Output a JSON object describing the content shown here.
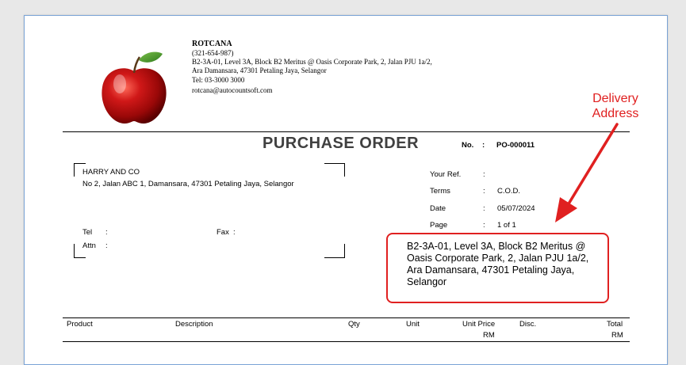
{
  "company": {
    "name": "ROTCANA",
    "phone": "(321-654-987)",
    "address_line1": "B2-3A-01, Level 3A, Block B2 Meritus @ Oasis Corporate Park, 2, Jalan PJU 1a/2,",
    "address_line2": "Ara Damansara, 47301 Petaling Jaya, Selangor",
    "tel": "Tel: 03-3000 3000",
    "email": "rotcana@autocountsoft.com",
    "logo_icon": "apple-logo"
  },
  "document": {
    "title": "PURCHASE ORDER",
    "no_label": "No.",
    "no_colon": ":",
    "no_value": "PO-000011"
  },
  "supplier": {
    "name": "HARRY AND CO",
    "address": "No 2, Jalan ABC 1, Damansara, 47301 Petaling Jaya, Selangor",
    "tel_label": "Tel",
    "fax_label": "Fax",
    "attn_label": "Attn",
    "colon": ":"
  },
  "info": [
    {
      "label": "Your Ref.",
      "colon": ":",
      "value": ""
    },
    {
      "label": "Terms",
      "colon": ":",
      "value": "C.O.D."
    },
    {
      "label": "Date",
      "colon": ":",
      "value": "05/07/2024"
    },
    {
      "label": "Page",
      "colon": ":",
      "value": "1 of 1"
    }
  ],
  "delivery": {
    "address": "B2-3A-01, Level 3A, Block B2 Meritus @ Oasis Corporate Park, 2, Jalan PJU 1a/2, Ara Damansara, 47301 Petaling Jaya, Selangor",
    "annotation_line1": "Delivery",
    "annotation_line2": "Address",
    "annotation_color": "#e02020"
  },
  "table": {
    "headers": [
      "Product",
      "Description",
      "Qty",
      "Unit",
      "Unit Price",
      "Disc.",
      "Total"
    ],
    "subheaders": {
      "unit_price": "RM",
      "total": "RM"
    }
  }
}
